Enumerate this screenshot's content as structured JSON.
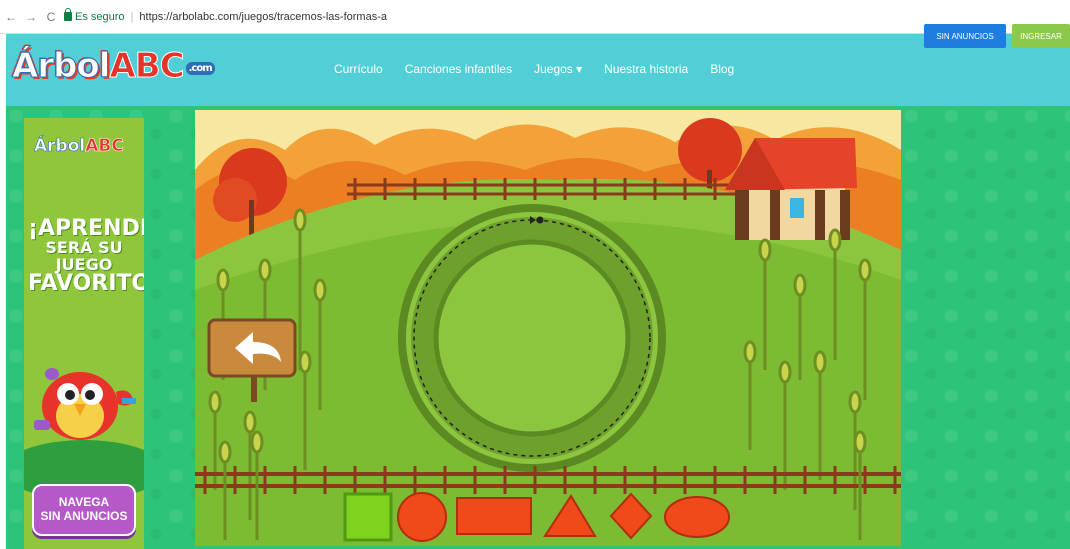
{
  "browser": {
    "back_label": "←",
    "forward_label": "→",
    "reload_label": "C",
    "secure_label": "Es seguro",
    "url": "https://arbolabc.com/juegos/tracemos-las-formas-a"
  },
  "header": {
    "logo_a": "Árbol",
    "logo_abc": "ABC",
    "logo_com": ".com",
    "nav": [
      "Currículo",
      "Canciones infantiles",
      "Juegos ▾",
      "Nuestra historia",
      "Blog"
    ],
    "btn_sin_anuncios": "SIN ANUNCIOS",
    "btn_ingresar": "INGRESAR",
    "bg_color": "#52cfd6"
  },
  "ad": {
    "logo_a": "Árbol",
    "logo_abc": "ABC",
    "line1": "¡APRENDER",
    "line2": "SERÁ SU JUEGO",
    "line3": "FAVORITO!",
    "button_line1": "NAVEGA",
    "button_line2": "SIN ANUNCIOS",
    "bg_color": "#8fc63c"
  },
  "game": {
    "shapes": [
      {
        "name": "square",
        "color": "#7ed321"
      },
      {
        "name": "circle",
        "color": "#f04a1b"
      },
      {
        "name": "rectangle",
        "color": "#f04a1b"
      },
      {
        "name": "triangle",
        "color": "#f04a1b"
      },
      {
        "name": "diamond",
        "color": "#f04a1b"
      },
      {
        "name": "oval",
        "color": "#f04a1b"
      }
    ],
    "back_icon": "back-arrow-icon",
    "grass_color": "#8cc63f"
  },
  "page": {
    "bg_color": "#2dc477"
  }
}
